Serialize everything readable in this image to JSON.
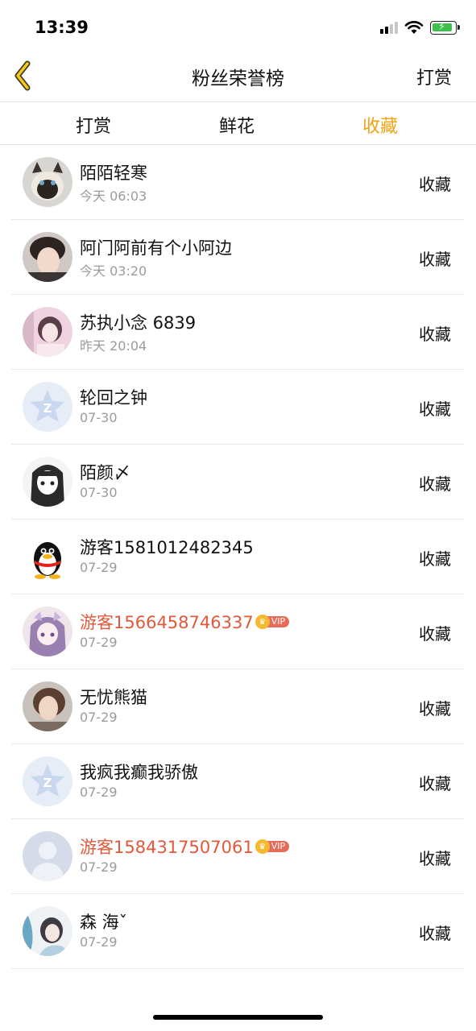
{
  "status_bar": {
    "time": "13:39"
  },
  "navbar": {
    "title": "粉丝荣誉榜",
    "right_label": "打赏"
  },
  "tabs": [
    {
      "label": "打赏",
      "active": false
    },
    {
      "label": "鲜花",
      "active": false
    },
    {
      "label": "收藏",
      "active": true
    }
  ],
  "colors": {
    "accent": "#f2a212",
    "vip_name": "#e2583b",
    "secondary_text": "#9b9b9b"
  },
  "items": [
    {
      "name": "陌陌轻寒",
      "time": "今天 06:03",
      "action": "收藏",
      "vip": false,
      "vip_label": "",
      "avatar": "siamese-cat-photo"
    },
    {
      "name": "阿门阿前有个小阿边",
      "time": "今天 03:20",
      "action": "收藏",
      "vip": false,
      "vip_label": "",
      "avatar": "person-photo"
    },
    {
      "name": "苏执小念 6839",
      "time": "昨天 20:04",
      "action": "收藏",
      "vip": false,
      "vip_label": "",
      "avatar": "pink-girl-photo"
    },
    {
      "name": "轮回之钟",
      "time": "07-30",
      "action": "收藏",
      "vip": false,
      "vip_label": "",
      "avatar": "default-z-avatar"
    },
    {
      "name": "陌颜〆",
      "time": "07-30",
      "action": "收藏",
      "vip": false,
      "vip_label": "",
      "avatar": "anime-girl-sketch"
    },
    {
      "name": "游客1581012482345",
      "time": "07-29",
      "action": "收藏",
      "vip": false,
      "vip_label": "",
      "avatar": "qq-penguin"
    },
    {
      "name": "游客1566458746337",
      "time": "07-29",
      "action": "收藏",
      "vip": true,
      "vip_label": "VIP",
      "avatar": "anime-girl-color"
    },
    {
      "name": "无忧熊猫",
      "time": "07-29",
      "action": "收藏",
      "vip": false,
      "vip_label": "",
      "avatar": "girl-photo"
    },
    {
      "name": "我疯我癫我骄傲",
      "time": "07-29",
      "action": "收藏",
      "vip": false,
      "vip_label": "",
      "avatar": "default-z-avatar"
    },
    {
      "name": "游客1584317507061",
      "time": "07-29",
      "action": "收藏",
      "vip": true,
      "vip_label": "VIP",
      "avatar": "default-person-avatar"
    },
    {
      "name": "森 海ˇ",
      "time": "07-29",
      "action": "收藏",
      "vip": false,
      "vip_label": "",
      "avatar": "watercolor-photo"
    }
  ]
}
